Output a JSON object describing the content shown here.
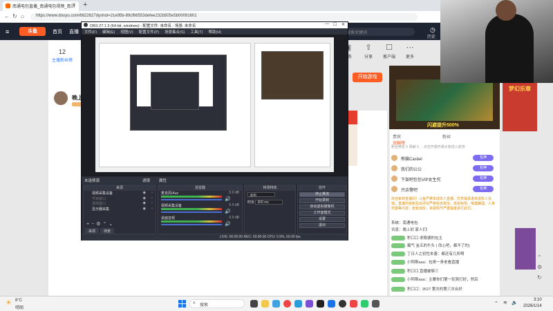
{
  "browser": {
    "tab_title": "南通电包直播_南通电包视频_南浒",
    "url": "https://www.douyu.com/6622627dyshid=21e95b-89cf66553defee232b505e5b00091601"
  },
  "site": {
    "logo": "斗鱼",
    "nav": [
      "首页",
      "直播"
    ],
    "search_placeholder": "搜索关键词",
    "history_label": "历史",
    "follow_count": "12",
    "follow_label": "主播粉丝榜",
    "anchor_name": "晚上",
    "top_icons": [
      "任务",
      "分享",
      "客户端",
      "更多"
    ],
    "start_game": "开始游戏"
  },
  "ad": {
    "text": "闪避提升500%"
  },
  "chat": {
    "tabs": [
      "贵宾",
      "粉丝",
      "贡献榜"
    ],
    "sub": "粉丝排名 5  贡献 0  ...  点击开通开通大家进入前排",
    "rank_rows": [
      {
        "name": "熊猫Casbel",
        "badge": "包神"
      },
      {
        "name": "我们的公公",
        "badge": "包神"
      },
      {
        "name": "下架吧包包VIP女生究",
        "badge": "包神"
      },
      {
        "name": "只余警吧",
        "badge": "包神"
      }
    ],
    "notice": "欢迎来到直播间！斗鱼严禁未成年人直播、打赏或承诺未成年人充值，直播内容和互动评论严禁包含政治、低俗色情、吸烟酗酒、人身伤害等内容，若有违反，将视情节严重程度进行处罚。",
    "messages": [
      "系统：南通电包",
      "讯息：晚上好 家人们!",
      "积口口  求稳德的包主",
      "霸气  金五的牛头  ( 改心吧，都不了的)",
      "丁日人之初性本善：都还有几所啊",
      "小阿斯aaa：包哥一来老看直播",
      "积口口  直播被够三",
      "小阿斯aaa：主要你们第一轮哭打好，然后",
      "积口口：9527 第次的第三次合好"
    ]
  },
  "right_ad": {
    "title": "梦幻乐章"
  },
  "obs": {
    "title": "OBS 27.1.3 (64-bit, windows) - 配置文件: 未命名 - 场景: 未命名",
    "menu": [
      "文件(F)",
      "编辑(E)",
      "视图(V)",
      "配置文件(P)",
      "场景集合(S)",
      "工具(T)",
      "帮助(H)"
    ],
    "no_source": "未选择源",
    "filters": "滤镜",
    "properties": "属性",
    "docks": {
      "scenes": "来源",
      "mixer": "混音器",
      "transitions": "转场特效",
      "controls": "控件"
    },
    "sources": [
      {
        "name": "视频采集设备",
        "dim": false
      },
      {
        "name": "节目窗口",
        "dim": true
      },
      {
        "name": "游戏窗口",
        "dim": true
      },
      {
        "name": "显示器采集",
        "dim": false
      }
    ],
    "scene_tabs": [
      "来源",
      "场景"
    ],
    "mixer": [
      {
        "name": "麦克风/Aux",
        "db": "0.0 dB"
      },
      {
        "name": "视频采集设备",
        "db": "0.0 dB"
      },
      {
        "name": "桌面音频",
        "db": "0.0 dB"
      }
    ],
    "transition": {
      "type": "淡出",
      "duration_label": "时长",
      "duration": "300 ms"
    },
    "controls": [
      {
        "label": "停止推流",
        "active": true
      },
      {
        "label": "开始录制",
        "active": false
      },
      {
        "label": "启动虚拟摄像机",
        "active": false
      },
      {
        "label": "工作室模式",
        "active": false
      },
      {
        "label": "设置",
        "active": false
      },
      {
        "label": "退出",
        "active": false
      }
    ],
    "status": "LIVE: 00:00:00     REC: 00:00:00     CPU: 0.9%, 60.00 fps"
  },
  "taskbar": {
    "temp": "8°C",
    "weather": "晴朗",
    "search": "搜索",
    "time": "3:10",
    "date": "2026/1/14"
  }
}
